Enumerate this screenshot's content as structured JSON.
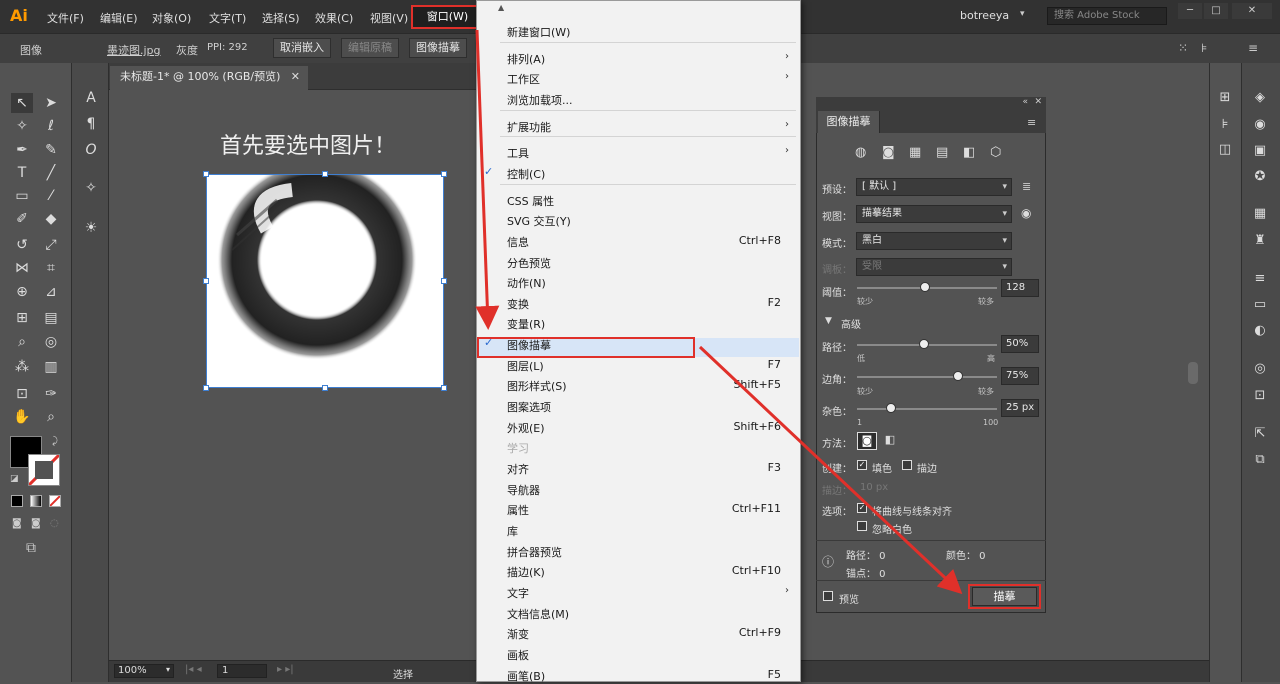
{
  "app": {
    "logo": "Ai",
    "user": "botreeya",
    "stock_search": "搜索 Adobe Stock"
  },
  "menubar": [
    "文件(F)",
    "编辑(E)",
    "对象(O)",
    "文字(T)",
    "选择(S)",
    "效果(C)",
    "视图(V)"
  ],
  "menu_window": "窗口(W)",
  "control": {
    "label": "图像",
    "filename": "墨迹图.jpg",
    "mode": "灰度",
    "ppi": "PPI: 292",
    "unembed": "取消嵌入",
    "edit_orig": "编辑原稿",
    "trace": "图像描摹"
  },
  "document": {
    "tab": "未标题-1* @ 100% (RGB/预览)",
    "heading": "首先要选中图片！",
    "zoom": "100%",
    "page": "1",
    "status": "选择"
  },
  "dropdown": [
    {
      "label": "新建窗口(W)",
      "shortcut": "",
      "arrow": false,
      "check": false,
      "disabled": false,
      "sep_after": true
    },
    {
      "label": "排列(A)",
      "shortcut": "",
      "arrow": true,
      "check": false,
      "disabled": false,
      "sep_after": false
    },
    {
      "label": "工作区",
      "shortcut": "",
      "arrow": true,
      "check": false,
      "disabled": false,
      "sep_after": false
    },
    {
      "label": "浏览加载项...",
      "shortcut": "",
      "arrow": false,
      "check": false,
      "disabled": false,
      "sep_after": true
    },
    {
      "label": "扩展功能",
      "shortcut": "",
      "arrow": true,
      "check": false,
      "disabled": false,
      "sep_after": true
    },
    {
      "label": "工具",
      "shortcut": "",
      "arrow": true,
      "check": false,
      "disabled": false,
      "sep_after": false
    },
    {
      "label": "控制(C)",
      "shortcut": "",
      "arrow": false,
      "check": true,
      "disabled": false,
      "sep_after": true
    },
    {
      "label": "CSS 属性",
      "shortcut": "",
      "arrow": false,
      "check": false,
      "disabled": false,
      "sep_after": false
    },
    {
      "label": "SVG 交互(Y)",
      "shortcut": "",
      "arrow": false,
      "check": false,
      "disabled": false,
      "sep_after": false
    },
    {
      "label": "信息",
      "shortcut": "Ctrl+F8",
      "arrow": false,
      "check": false,
      "disabled": false,
      "sep_after": false
    },
    {
      "label": "分色预览",
      "shortcut": "",
      "arrow": false,
      "check": false,
      "disabled": false,
      "sep_after": false
    },
    {
      "label": "动作(N)",
      "shortcut": "",
      "arrow": false,
      "check": false,
      "disabled": false,
      "sep_after": false
    },
    {
      "label": "变换",
      "shortcut": "F2",
      "arrow": false,
      "check": false,
      "disabled": false,
      "sep_after": false
    },
    {
      "label": "变量(R)",
      "shortcut": "",
      "arrow": false,
      "check": false,
      "disabled": false,
      "sep_after": false
    },
    {
      "label": "图像描摹",
      "shortcut": "",
      "arrow": false,
      "check": true,
      "disabled": false,
      "sep_after": false
    },
    {
      "label": "图层(L)",
      "shortcut": "F7",
      "arrow": false,
      "check": false,
      "disabled": false,
      "sep_after": false
    },
    {
      "label": "图形样式(S)",
      "shortcut": "Shift+F5",
      "arrow": false,
      "check": false,
      "disabled": false,
      "sep_after": false
    },
    {
      "label": "图案选项",
      "shortcut": "",
      "arrow": false,
      "check": false,
      "disabled": false,
      "sep_after": false
    },
    {
      "label": "外观(E)",
      "shortcut": "Shift+F6",
      "arrow": false,
      "check": false,
      "disabled": false,
      "sep_after": false
    },
    {
      "label": "学习",
      "shortcut": "",
      "arrow": false,
      "check": false,
      "disabled": true,
      "sep_after": false
    },
    {
      "label": "对齐",
      "shortcut": "F3",
      "arrow": false,
      "check": false,
      "disabled": false,
      "sep_after": false
    },
    {
      "label": "导航器",
      "shortcut": "",
      "arrow": false,
      "check": false,
      "disabled": false,
      "sep_after": false
    },
    {
      "label": "属性",
      "shortcut": "Ctrl+F11",
      "arrow": false,
      "check": false,
      "disabled": false,
      "sep_after": false
    },
    {
      "label": "库",
      "shortcut": "",
      "arrow": false,
      "check": false,
      "disabled": false,
      "sep_after": false
    },
    {
      "label": "拼合器预览",
      "shortcut": "",
      "arrow": false,
      "check": false,
      "disabled": false,
      "sep_after": false
    },
    {
      "label": "描边(K)",
      "shortcut": "Ctrl+F10",
      "arrow": false,
      "check": false,
      "disabled": false,
      "sep_after": false
    },
    {
      "label": "文字",
      "shortcut": "",
      "arrow": true,
      "check": false,
      "disabled": false,
      "sep_after": false
    },
    {
      "label": "文档信息(M)",
      "shortcut": "",
      "arrow": false,
      "check": false,
      "disabled": false,
      "sep_after": false
    },
    {
      "label": "渐变",
      "shortcut": "Ctrl+F9",
      "arrow": false,
      "check": false,
      "disabled": false,
      "sep_after": false
    },
    {
      "label": "画板",
      "shortcut": "",
      "arrow": false,
      "check": false,
      "disabled": false,
      "sep_after": false
    },
    {
      "label": "画笔(B)",
      "shortcut": "F5",
      "arrow": false,
      "check": false,
      "disabled": false,
      "sep_after": false
    }
  ],
  "trace_panel": {
    "tab": "图像描摹",
    "preset_label": "预设：",
    "preset_value": "[ 默认 ]",
    "view_label": "视图：",
    "view_value": "描摹结果",
    "mode_label": "模式：",
    "mode_value": "黑白",
    "palette_label": "调板：",
    "palette_value": "受限",
    "threshold_label": "阈值：",
    "threshold_value": "128",
    "threshold_low": "较少",
    "threshold_high": "较多",
    "advanced": "高级",
    "paths_label": "路径：",
    "paths_value": "50%",
    "paths_low": "低",
    "paths_high": "高",
    "corners_label": "边角：",
    "corners_value": "75%",
    "corners_low": "较少",
    "corners_high": "较多",
    "noise_label": "杂色：",
    "noise_value": "25 px",
    "noise_min": "1",
    "noise_max": "100",
    "method_label": "方法：",
    "create_label": "创建：",
    "fill_label": "填色",
    "stroke_label": "描边",
    "stroke_label2": "描边：",
    "stroke_value": "10 px",
    "options_label": "选项：",
    "snap_label": "将曲线与线条对齐",
    "ignore_white": "忽略白色",
    "info_paths": "路径：  0",
    "info_colors": "颜色：  0",
    "info_anchors": "锚点：  0",
    "preview": "预览",
    "trace_button": "描摹"
  },
  "colors": {
    "highlight_red": "#e0302a",
    "menu_bg": "#f2f2f2",
    "ui_dark": "#535353"
  }
}
